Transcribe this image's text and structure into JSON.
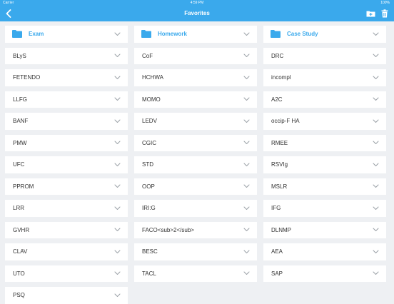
{
  "status_bar": {
    "carrier": "Carrier",
    "time": "4:59 PM",
    "battery": "100%"
  },
  "nav": {
    "title": "Favorites",
    "back_icon": "chevron-left-icon",
    "icons": [
      "new-folder-icon",
      "trash-icon"
    ]
  },
  "colors": {
    "accent": "#3aa9ec",
    "background": "#eef0f3",
    "cell": "#ffffff",
    "text": "#333333"
  },
  "folders": [
    {
      "label": "Exam"
    },
    {
      "label": "Homework"
    },
    {
      "label": "Case Study"
    }
  ],
  "items": [
    {
      "label": "BLyS"
    },
    {
      "label": "CoF"
    },
    {
      "label": "DRC"
    },
    {
      "label": "FETENDO"
    },
    {
      "label": "HCHWA"
    },
    {
      "label": "incompl"
    },
    {
      "label": "LLFG"
    },
    {
      "label": "MOMO"
    },
    {
      "label": "A2C"
    },
    {
      "label": "BANF"
    },
    {
      "label": "LEDV"
    },
    {
      "label": "occip-F HA"
    },
    {
      "label": "PMW"
    },
    {
      "label": "CGIC"
    },
    {
      "label": "RMEE"
    },
    {
      "label": "UFC"
    },
    {
      "label": "STD"
    },
    {
      "label": "RSVIg"
    },
    {
      "label": "PPROM"
    },
    {
      "label": "OOP"
    },
    {
      "label": "MSLR"
    },
    {
      "label": "LRR"
    },
    {
      "label": "IRI:G"
    },
    {
      "label": "IFG"
    },
    {
      "label": "GVHR"
    },
    {
      "label": "FACO<sub>2</sub>"
    },
    {
      "label": "DLNMP"
    },
    {
      "label": "CLAV"
    },
    {
      "label": "BESC"
    },
    {
      "label": "AEA"
    },
    {
      "label": "UTO"
    },
    {
      "label": "TACL"
    },
    {
      "label": "SAP"
    },
    {
      "label": "PSQ"
    }
  ]
}
